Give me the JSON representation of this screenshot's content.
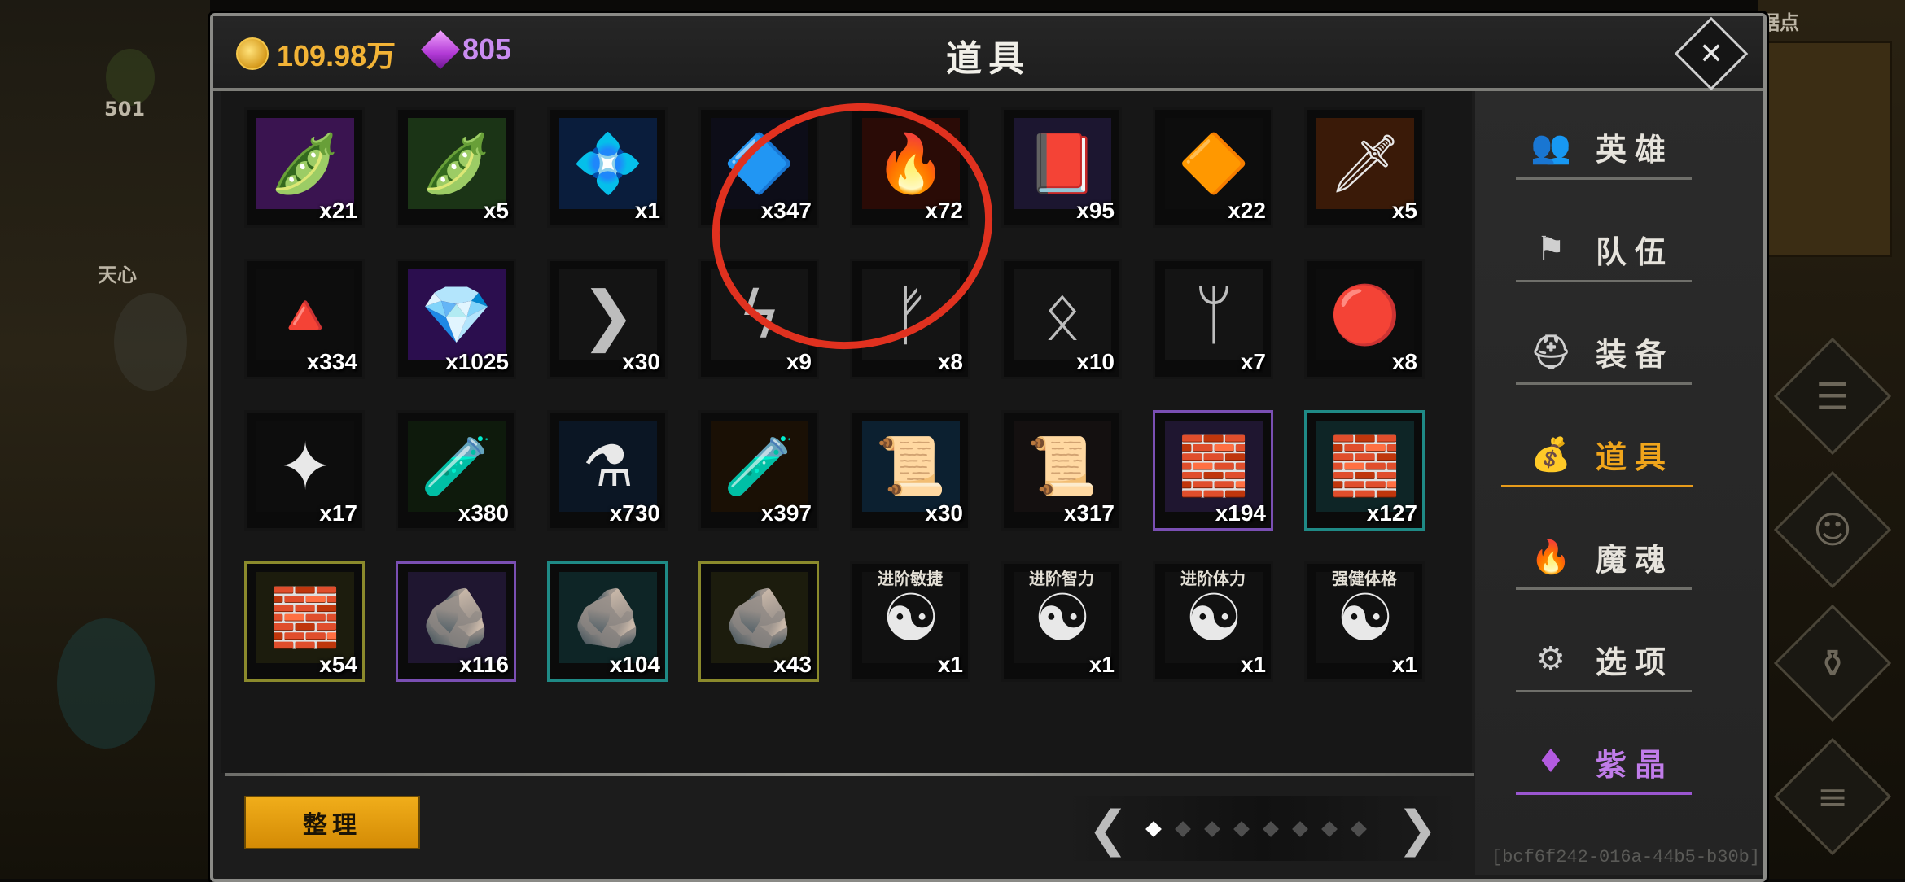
{
  "background": {
    "left_count": "501",
    "left_label": "天心",
    "right_label": "据点"
  },
  "header": {
    "gold": "109.98万",
    "gems": "805",
    "title": "道具",
    "gold_color": "#f2b336",
    "gem_color": "#c98cf0"
  },
  "items": [
    {
      "name": "purple-seed-pod",
      "count": "x21",
      "frame": "none",
      "icon": "🫛",
      "bg": "#3a1450"
    },
    {
      "name": "green-seed-pod",
      "count": "x5",
      "frame": "none",
      "icon": "🫛",
      "bg": "#1b3416"
    },
    {
      "name": "blue-crystal",
      "count": "x1",
      "frame": "none",
      "icon": "💠",
      "bg": "#0a1d3c"
    },
    {
      "name": "prism-crystal",
      "count": "x347",
      "frame": "none",
      "icon": "🔷",
      "bg": "#0d0d18"
    },
    {
      "name": "fire-orb",
      "count": "x72",
      "frame": "none",
      "icon": "🔥",
      "bg": "#2a0b06"
    },
    {
      "name": "purple-tome",
      "count": "x95",
      "frame": "none",
      "icon": "📕",
      "bg": "#1c1630"
    },
    {
      "name": "red-gem",
      "count": "x22",
      "frame": "none",
      "icon": "🔶",
      "bg": "#0d0d0d"
    },
    {
      "name": "flame-blade",
      "count": "x5",
      "frame": "none",
      "icon": "🗡",
      "bg": "#3a1a08"
    },
    {
      "name": "red-shard",
      "count": "x334",
      "frame": "none",
      "icon": "🔺",
      "bg": "#0d0d0d"
    },
    {
      "name": "purple-gem",
      "count": "x1025",
      "frame": "none",
      "icon": "💎",
      "bg": "#2b0e4e"
    },
    {
      "name": "rune-sowilo-chevron",
      "count": "x30",
      "frame": "none",
      "icon": "❯",
      "bg": "#141414"
    },
    {
      "name": "rune-sowilo",
      "count": "x9",
      "frame": "none",
      "icon": "ϟ",
      "bg": "#141414"
    },
    {
      "name": "rune-fehu",
      "count": "x8",
      "frame": "none",
      "icon": "ᚠ",
      "bg": "#141414"
    },
    {
      "name": "rune-othala",
      "count": "x10",
      "frame": "none",
      "icon": "ᛟ",
      "bg": "#141414"
    },
    {
      "name": "rune-algiz",
      "count": "x7",
      "frame": "none",
      "icon": "ᛘ",
      "bg": "#141414"
    },
    {
      "name": "red-swirl-orb",
      "count": "x8",
      "frame": "none",
      "icon": "🔴",
      "bg": "#0d0d0d"
    },
    {
      "name": "purple-crystal-cluster",
      "count": "x17",
      "frame": "none",
      "icon": "✦",
      "bg": "#0d0d0d"
    },
    {
      "name": "green-potion",
      "count": "x380",
      "frame": "none",
      "icon": "🧪",
      "bg": "#0e1a0c"
    },
    {
      "name": "blue-potion",
      "count": "x730",
      "frame": "none",
      "icon": "⚗",
      "bg": "#0b1624"
    },
    {
      "name": "orange-vial",
      "count": "x397",
      "frame": "none",
      "icon": "🧪",
      "bg": "#1a1005"
    },
    {
      "name": "blue-scroll",
      "count": "x30",
      "frame": "none",
      "icon": "📜",
      "bg": "#0c2030"
    },
    {
      "name": "ancient-scroll",
      "count": "x317",
      "frame": "none",
      "icon": "📜",
      "bg": "#141010"
    },
    {
      "name": "amber-fragment-purple",
      "count": "x194",
      "frame": "purple",
      "icon": "🧱",
      "bg": "#1f1630"
    },
    {
      "name": "amber-fragment-teal",
      "count": "x127",
      "frame": "teal",
      "icon": "🧱",
      "bg": "#0e2526"
    },
    {
      "name": "amber-fragment-gold",
      "count": "x54",
      "frame": "gold",
      "icon": "🧱",
      "bg": "#1c1c0d"
    },
    {
      "name": "red-ore-purple",
      "count": "x116",
      "frame": "purple",
      "icon": "🪨",
      "bg": "#1f1630"
    },
    {
      "name": "red-ore-teal",
      "count": "x104",
      "frame": "teal",
      "icon": "🪨",
      "bg": "#0e2526"
    },
    {
      "name": "red-ore-gold",
      "count": "x43",
      "frame": "gold",
      "icon": "🪨",
      "bg": "#1c1c0d"
    },
    {
      "name": "yinyang-agility",
      "count": "x1",
      "frame": "none",
      "icon": "☯",
      "bg": "#111111",
      "label": "进阶敏捷"
    },
    {
      "name": "yinyang-intellect",
      "count": "x1",
      "frame": "none",
      "icon": "☯",
      "bg": "#111111",
      "label": "进阶智力"
    },
    {
      "name": "yinyang-stamina",
      "count": "x1",
      "frame": "none",
      "icon": "☯",
      "bg": "#111111",
      "label": "进阶体力"
    },
    {
      "name": "yinyang-physique",
      "count": "x1",
      "frame": "none",
      "icon": "☯",
      "bg": "#111111",
      "label": "强健体格"
    }
  ],
  "footer": {
    "sort_label": "整理",
    "prev_arrow": "❮",
    "next_arrow": "❯",
    "page_count": 8,
    "current_page": 1
  },
  "menu": {
    "items": [
      {
        "label": "英雄",
        "icon": "users-icon",
        "glyph": "👥",
        "state": "normal"
      },
      {
        "label": "队伍",
        "icon": "flag-icon",
        "glyph": "⚑",
        "state": "normal"
      },
      {
        "label": "装备",
        "icon": "helmet-icon",
        "glyph": "⛑",
        "state": "normal"
      },
      {
        "label": "道具",
        "icon": "bag-icon",
        "glyph": "💰",
        "state": "active"
      },
      {
        "label": "魔魂",
        "icon": "flame-icon",
        "glyph": "🔥",
        "state": "normal"
      },
      {
        "label": "选项",
        "icon": "gear-icon",
        "glyph": "⚙",
        "state": "normal"
      },
      {
        "label": "紫晶",
        "icon": "crystal-icon",
        "glyph": "♦",
        "state": "crystal"
      }
    ],
    "active_color": "#f0a51b",
    "crystal_color": "#c07ce9",
    "build_id": "[bcf6f242-016a-44b5-b30b]"
  }
}
